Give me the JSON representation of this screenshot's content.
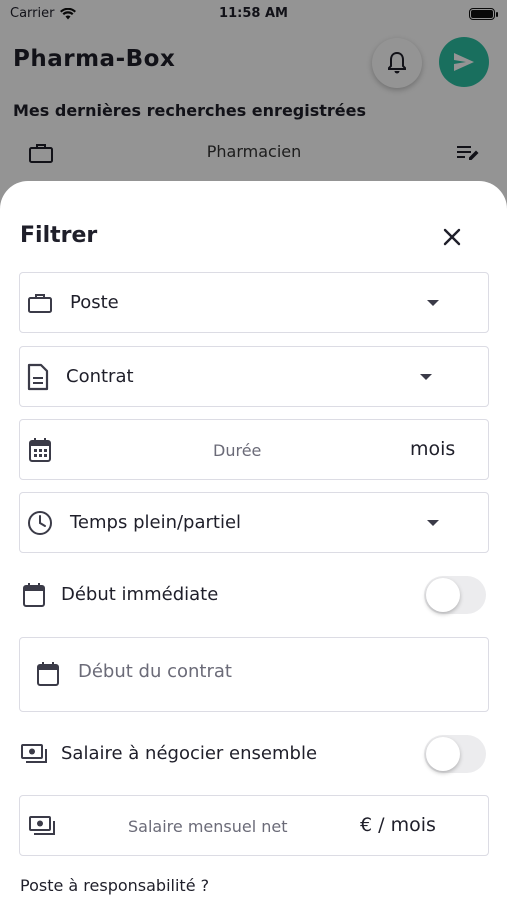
{
  "status_bar": {
    "carrier": "Carrier",
    "time": "11:58 AM"
  },
  "background": {
    "app_title": "Pharma-Box",
    "recent_title": "Mes dernières recherches enregistrées",
    "recent_item": "Pharmacien"
  },
  "sheet": {
    "title": "Filtrer",
    "fields": {
      "poste": {
        "label": "Poste",
        "icon": "briefcase-icon"
      },
      "contrat": {
        "label": "Contrat",
        "icon": "document-icon"
      },
      "duree": {
        "placeholder": "Durée",
        "suffix": "mois",
        "icon": "calendar-grid-icon"
      },
      "temps": {
        "label": "Temps plein/partiel",
        "icon": "clock-icon"
      },
      "debut_contrat": {
        "placeholder": "Début du contrat",
        "icon": "calendar-icon"
      },
      "salaire": {
        "placeholder": "Salaire mensuel net",
        "suffix": "€ / mois",
        "icon": "money-icon"
      }
    },
    "toggles": {
      "debut_immediate": {
        "label": "Début immédiate",
        "on": false,
        "icon": "calendar-icon"
      },
      "salaire_negocier": {
        "label": "Salaire à négocier ensemble",
        "on": false,
        "icon": "money-icon"
      }
    },
    "cut_off_label": "Poste à responsabilité ?"
  },
  "colors": {
    "accent": "#2bc0a3",
    "border": "#dcdce4",
    "text": "#1f1f2a"
  }
}
